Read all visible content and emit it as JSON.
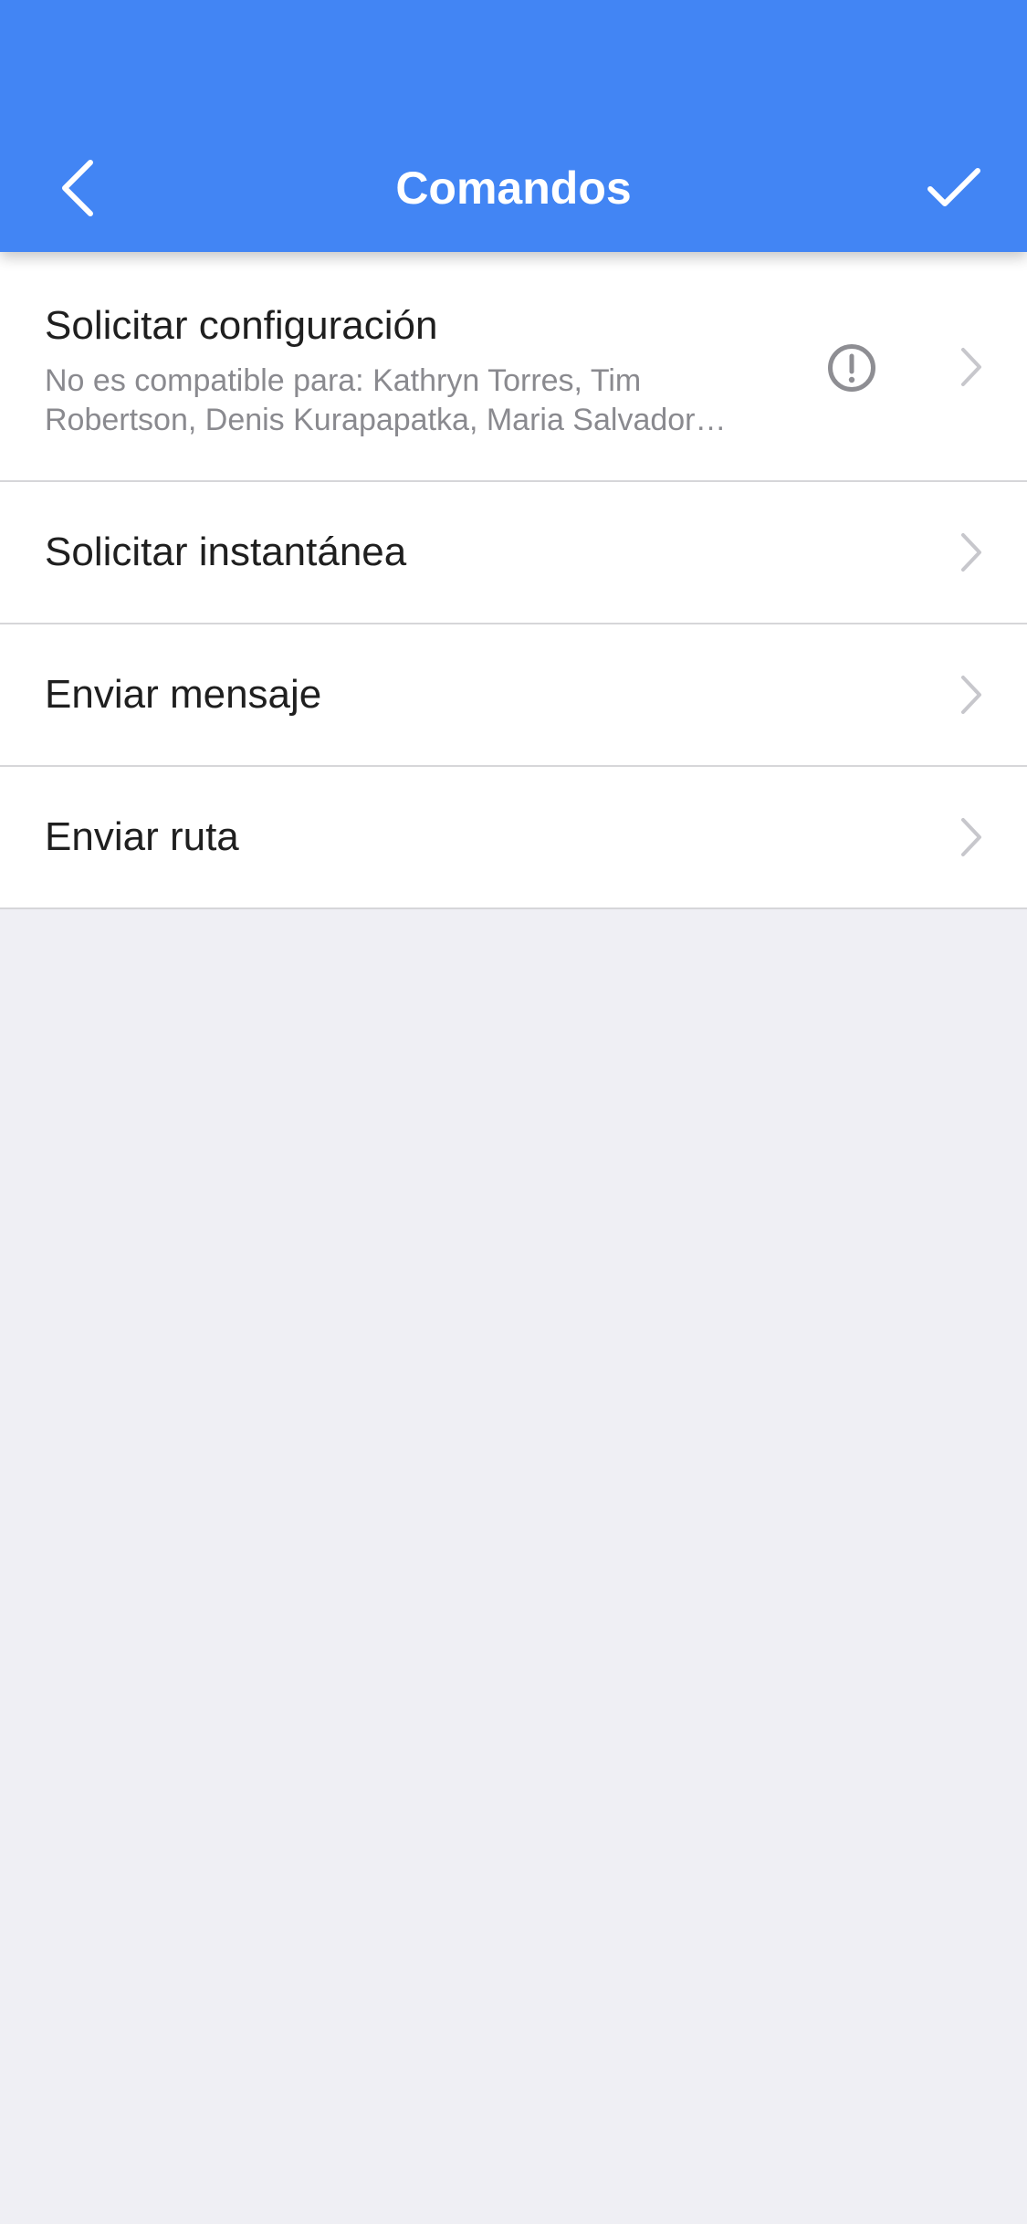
{
  "colors": {
    "header_background": "#4285f4",
    "header_foreground": "#ffffff",
    "list_background": "#ffffff",
    "page_background": "#efeff4",
    "title_text": "#1f1f1f",
    "subtitle_text": "#8a8a8f",
    "chevron": "#c7c7cc",
    "warning_icon": "#8e8e93"
  },
  "header": {
    "title": "Comandos",
    "back_icon": "chevron-left-icon",
    "confirm_icon": "checkmark-icon"
  },
  "commands": [
    {
      "title": "Solicitar configuración",
      "subtitle": "No es compatible para: Kathryn Torres, Tim Robertson, Denis Kurapapatka, Maria Salvador…",
      "status_icon": "warning-icon"
    },
    {
      "title": "Solicitar instantánea"
    },
    {
      "title": "Enviar mensaje"
    },
    {
      "title": "Enviar ruta"
    }
  ]
}
